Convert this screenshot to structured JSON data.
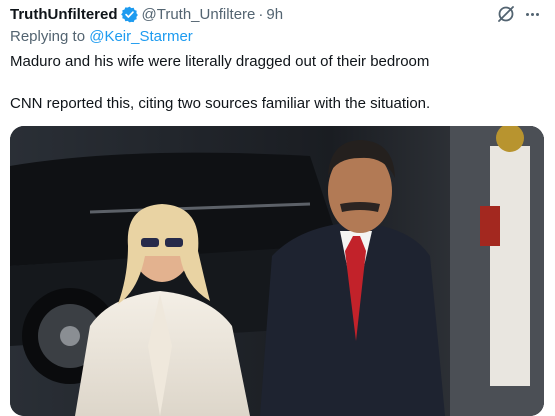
{
  "tweet": {
    "display_name": "TruthUnfiltered",
    "handle": "@Truth_Unfiltere",
    "separator": "·",
    "time": "9h",
    "replying_prefix": "Replying to",
    "replying_to": "@Keir_Starmer",
    "text_line1": "Maduro and his wife were literally dragged out of their bedroom",
    "text_line2": "CNN reported this, citing two sources familiar with the situation."
  },
  "icons": {
    "verified": "verified-badge-icon",
    "grok": "grok-icon",
    "more": "more-options-icon"
  },
  "colors": {
    "verified_blue": "#1d9bf0",
    "link_blue": "#1d9bf0",
    "secondary_text": "#536471",
    "primary_text": "#0f1419"
  }
}
